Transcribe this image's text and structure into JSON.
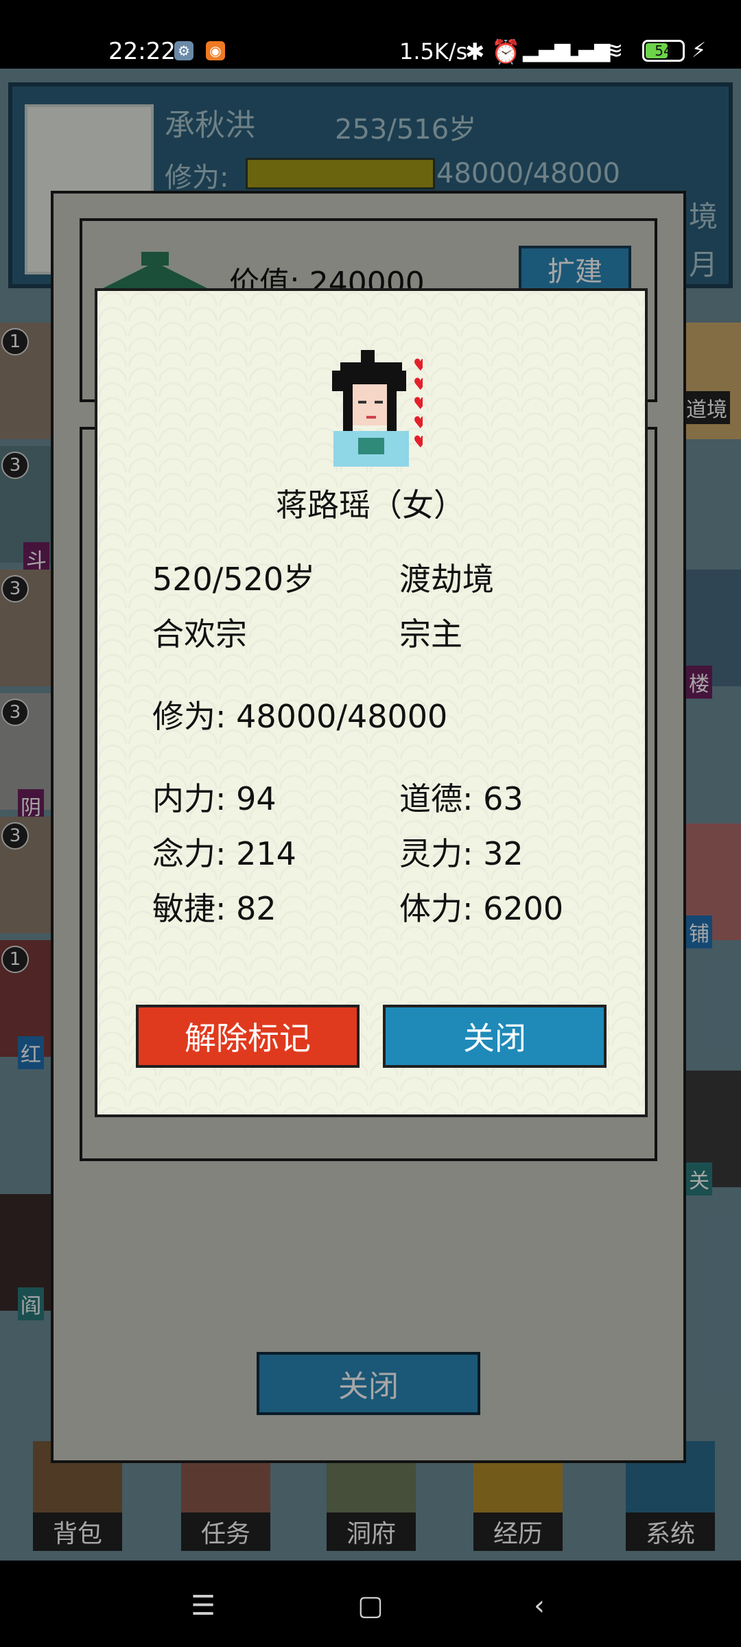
{
  "status_bar": {
    "time": "22:22",
    "network_speed": "1.5K/s",
    "battery": "54"
  },
  "header": {
    "player_name": "承秋洪",
    "age": "253/516岁",
    "cultivation_label": "修为:",
    "cultivation_value": "48000/48000",
    "realm_fragment": "境",
    "month_fragment": "月"
  },
  "background_panel": {
    "value_label": "价值: 240000",
    "expand_button": "扩建",
    "close_button": "关闭"
  },
  "side_items": {
    "left_badges": [
      "1",
      "3",
      "3",
      "3",
      "3",
      "1"
    ],
    "left_labels": [
      "斗",
      "阴",
      "红",
      "阎"
    ],
    "right_labels": [
      "道境",
      "楼",
      "铺",
      "关"
    ]
  },
  "bottom_nav": [
    "背包",
    "任务",
    "洞府",
    "经历",
    "系统"
  ],
  "character_dialog": {
    "name": "蒋路瑶（女）",
    "age": "520/520岁",
    "realm": "渡劫境",
    "sect": "合欢宗",
    "position": "宗主",
    "cultivation": "修为: 48000/48000",
    "inner_power": "内力: 94",
    "morality": "道德: 63",
    "mind_power": "念力: 214",
    "spirit_power": "灵力: 32",
    "agility": "敏捷: 82",
    "stamina": "体力: 6200",
    "unmark_button": "解除标记",
    "close_button": "关闭"
  },
  "colors": {
    "danger_button": "#e03a1e",
    "primary_button": "#1f8ab8",
    "dialog_bg": "#f1f3e3"
  }
}
